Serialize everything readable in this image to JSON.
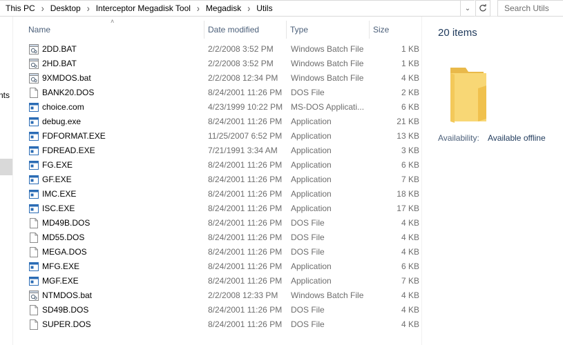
{
  "breadcrumb": [
    "This PC",
    "Desktop",
    "Interceptor Megadisk Tool",
    "Megadisk",
    "Utils"
  ],
  "search": {
    "placeholder": "Search Utils"
  },
  "nav": {
    "partial_label": "nts"
  },
  "columns": {
    "name": "Name",
    "date": "Date modified",
    "type": "Type",
    "size": "Size"
  },
  "files": [
    {
      "name": "2DD.BAT",
      "date": "2/2/2008 3:52 PM",
      "type": "Windows Batch File",
      "size": "1 KB",
      "icon": "batch-icon"
    },
    {
      "name": "2HD.BAT",
      "date": "2/2/2008 3:52 PM",
      "type": "Windows Batch File",
      "size": "1 KB",
      "icon": "batch-icon"
    },
    {
      "name": "9XMDOS.bat",
      "date": "2/2/2008 12:34 PM",
      "type": "Windows Batch File",
      "size": "4 KB",
      "icon": "batch-icon"
    },
    {
      "name": "BANK20.DOS",
      "date": "8/24/2001 11:26 PM",
      "type": "DOS File",
      "size": "2 KB",
      "icon": "file-icon"
    },
    {
      "name": "choice.com",
      "date": "4/23/1999 10:22 PM",
      "type": "MS-DOS Applicati...",
      "size": "6 KB",
      "icon": "application-icon"
    },
    {
      "name": "debug.exe",
      "date": "8/24/2001 11:26 PM",
      "type": "Application",
      "size": "21 KB",
      "icon": "application-icon"
    },
    {
      "name": "FDFORMAT.EXE",
      "date": "11/25/2007 6:52 PM",
      "type": "Application",
      "size": "13 KB",
      "icon": "application-icon"
    },
    {
      "name": "FDREAD.EXE",
      "date": "7/21/1991 3:34 AM",
      "type": "Application",
      "size": "3 KB",
      "icon": "application-icon"
    },
    {
      "name": "FG.EXE",
      "date": "8/24/2001 11:26 PM",
      "type": "Application",
      "size": "6 KB",
      "icon": "application-icon"
    },
    {
      "name": "GF.EXE",
      "date": "8/24/2001 11:26 PM",
      "type": "Application",
      "size": "7 KB",
      "icon": "application-icon"
    },
    {
      "name": "IMC.EXE",
      "date": "8/24/2001 11:26 PM",
      "type": "Application",
      "size": "18 KB",
      "icon": "application-icon"
    },
    {
      "name": "ISC.EXE",
      "date": "8/24/2001 11:26 PM",
      "type": "Application",
      "size": "17 KB",
      "icon": "application-icon"
    },
    {
      "name": "MD49B.DOS",
      "date": "8/24/2001 11:26 PM",
      "type": "DOS File",
      "size": "4 KB",
      "icon": "file-icon"
    },
    {
      "name": "MD55.DOS",
      "date": "8/24/2001 11:26 PM",
      "type": "DOS File",
      "size": "4 KB",
      "icon": "file-icon"
    },
    {
      "name": "MEGA.DOS",
      "date": "8/24/2001 11:26 PM",
      "type": "DOS File",
      "size": "4 KB",
      "icon": "file-icon"
    },
    {
      "name": "MFG.EXE",
      "date": "8/24/2001 11:26 PM",
      "type": "Application",
      "size": "6 KB",
      "icon": "application-icon"
    },
    {
      "name": "MGF.EXE",
      "date": "8/24/2001 11:26 PM",
      "type": "Application",
      "size": "7 KB",
      "icon": "application-icon"
    },
    {
      "name": "NTMDOS.bat",
      "date": "2/2/2008 12:33 PM",
      "type": "Windows Batch File",
      "size": "4 KB",
      "icon": "batch-icon"
    },
    {
      "name": "SD49B.DOS",
      "date": "8/24/2001 11:26 PM",
      "type": "DOS File",
      "size": "4 KB",
      "icon": "file-icon"
    },
    {
      "name": "SUPER.DOS",
      "date": "8/24/2001 11:26 PM",
      "type": "DOS File",
      "size": "4 KB",
      "icon": "file-icon"
    }
  ],
  "details": {
    "count": "20 items",
    "availability_label": "Availability:",
    "availability_value": "Available offline"
  },
  "colors": {
    "header_text": "#4c607a",
    "detail_text": "#1e395b",
    "secondary_text": "#6d6d6d",
    "folder": "#f8d775"
  }
}
